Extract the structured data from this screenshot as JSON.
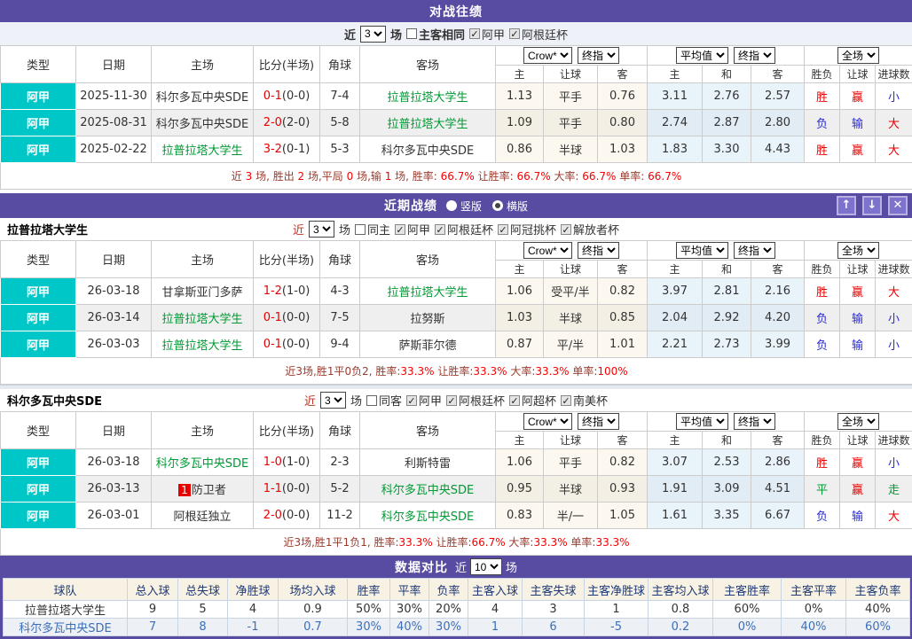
{
  "colors": {
    "purple": "#584CA2",
    "teal": "#00C7C7",
    "team_green": "#009933",
    "win_red": "#E60000",
    "lose_blue": "#2A2AD4",
    "draw_green": "#019934",
    "avg_bg": "#E9F3FA",
    "odds_bg": "#FCF8EF"
  },
  "thead": {
    "type": "类型",
    "date": "日期",
    "home": "主场",
    "score": "比分(半场)",
    "corner": "角球",
    "away": "客场",
    "crow": "Crow*",
    "final": "终指",
    "avg": "平均值",
    "full": "全场",
    "h_home": "主",
    "h_handicap": "让球",
    "h_away": "客",
    "a_home": "主",
    "a_draw": "和",
    "a_away": "客",
    "r_result": "胜负",
    "r_handicap": "让球",
    "r_goals": "进球数"
  },
  "h2h": {
    "title": "对战往绩",
    "filter": {
      "near": "近",
      "count": "3",
      "unit": "场",
      "checks": [
        {
          "label": "主客相同",
          "checked": false
        },
        {
          "label": "阿甲",
          "checked": true
        },
        {
          "label": "阿根廷杯",
          "checked": true
        }
      ]
    },
    "rows": [
      {
        "type": "阿甲",
        "date": "2025-11-30",
        "home": "科尔多瓦中央SDE",
        "home_green": false,
        "badge": "",
        "score": "0-1",
        "half": "(0-0)",
        "corner": "7-4",
        "away": "拉普拉塔大学生",
        "away_green": true,
        "o1": "1.13",
        "o2": "平手",
        "o3": "0.76",
        "a1": "3.11",
        "a2": "2.76",
        "a3": "2.57",
        "r1": {
          "t": "胜",
          "c": "red"
        },
        "r2": {
          "t": "赢",
          "c": "red"
        },
        "r3": {
          "t": "小",
          "c": "blue"
        }
      },
      {
        "type": "阿甲",
        "date": "2025-08-31",
        "home": "科尔多瓦中央SDE",
        "home_green": false,
        "badge": "",
        "score": "2-0",
        "half": "(2-0)",
        "corner": "5-8",
        "away": "拉普拉塔大学生",
        "away_green": true,
        "o1": "1.09",
        "o2": "平手",
        "o3": "0.80",
        "a1": "2.74",
        "a2": "2.87",
        "a3": "2.80",
        "r1": {
          "t": "负",
          "c": "blue"
        },
        "r2": {
          "t": "输",
          "c": "blue"
        },
        "r3": {
          "t": "大",
          "c": "red"
        }
      },
      {
        "type": "阿甲",
        "date": "2025-02-22",
        "home": "拉普拉塔大学生",
        "home_green": true,
        "badge": "",
        "score": "3-2",
        "half": "(0-1)",
        "corner": "5-3",
        "away": "科尔多瓦中央SDE",
        "away_green": false,
        "o1": "0.86",
        "o2": "半球",
        "o3": "1.03",
        "a1": "1.83",
        "a2": "3.30",
        "a3": "4.43",
        "r1": {
          "t": "胜",
          "c": "red"
        },
        "r2": {
          "t": "赢",
          "c": "red"
        },
        "r3": {
          "t": "大",
          "c": "red"
        }
      }
    ],
    "summary": [
      {
        "t": "近 ",
        "c": "dk"
      },
      {
        "t": "3",
        "c": "red"
      },
      {
        "t": " 场, 胜出 ",
        "c": "dk"
      },
      {
        "t": "2",
        "c": "red"
      },
      {
        "t": " 场,平局 ",
        "c": "dk"
      },
      {
        "t": "0",
        "c": "red"
      },
      {
        "t": " 场,输 ",
        "c": "dk"
      },
      {
        "t": "1",
        "c": "red"
      },
      {
        "t": " 场, 胜率: ",
        "c": "dk"
      },
      {
        "t": "66.7%",
        "c": "red"
      },
      {
        "t": " 让胜率: ",
        "c": "dk"
      },
      {
        "t": "66.7%",
        "c": "red"
      },
      {
        "t": " 大率: ",
        "c": "dk"
      },
      {
        "t": "66.7%",
        "c": "red"
      },
      {
        "t": " 单率: ",
        "c": "dk"
      },
      {
        "t": "66.7%",
        "c": "red"
      }
    ]
  },
  "recent": {
    "title": "近期战绩",
    "radios": [
      {
        "label": "竖版",
        "checked": false
      },
      {
        "label": "横版",
        "checked": true
      }
    ],
    "buttons": {
      "up": "↑",
      "down": "↓",
      "close": "✕"
    },
    "teams": [
      {
        "name": "拉普拉塔大学生",
        "filter": {
          "near": "近",
          "count": "3",
          "unit": "场",
          "checks": [
            {
              "label": "同主",
              "checked": false
            },
            {
              "label": "阿甲",
              "checked": true
            },
            {
              "label": "阿根廷杯",
              "checked": true
            },
            {
              "label": "阿冠挑杯",
              "checked": true
            },
            {
              "label": "解放者杯",
              "checked": true
            }
          ]
        },
        "rows": [
          {
            "type": "阿甲",
            "date": "26-03-18",
            "home": "甘拿斯亚门多萨",
            "home_green": false,
            "badge": "",
            "score": "1-2",
            "half": "(1-0)",
            "corner": "4-3",
            "away": "拉普拉塔大学生",
            "away_green": true,
            "o1": "1.06",
            "o2": "受平/半",
            "o3": "0.82",
            "a1": "3.97",
            "a2": "2.81",
            "a3": "2.16",
            "r1": {
              "t": "胜",
              "c": "red"
            },
            "r2": {
              "t": "赢",
              "c": "red"
            },
            "r3": {
              "t": "大",
              "c": "red"
            }
          },
          {
            "type": "阿甲",
            "date": "26-03-14",
            "home": "拉普拉塔大学生",
            "home_green": true,
            "badge": "",
            "score": "0-1",
            "half": "(0-0)",
            "corner": "7-5",
            "away": "拉努斯",
            "away_green": false,
            "o1": "1.03",
            "o2": "半球",
            "o3": "0.85",
            "a1": "2.04",
            "a2": "2.92",
            "a3": "4.20",
            "r1": {
              "t": "负",
              "c": "blue"
            },
            "r2": {
              "t": "输",
              "c": "blue"
            },
            "r3": {
              "t": "小",
              "c": "blue"
            }
          },
          {
            "type": "阿甲",
            "date": "26-03-03",
            "home": "拉普拉塔大学生",
            "home_green": true,
            "badge": "",
            "score": "0-1",
            "half": "(0-0)",
            "corner": "9-4",
            "away": "萨斯菲尔德",
            "away_green": false,
            "o1": "0.87",
            "o2": "平/半",
            "o3": "1.01",
            "a1": "2.21",
            "a2": "2.73",
            "a3": "3.99",
            "r1": {
              "t": "负",
              "c": "blue"
            },
            "r2": {
              "t": "输",
              "c": "blue"
            },
            "r3": {
              "t": "小",
              "c": "blue"
            }
          }
        ],
        "summary": [
          {
            "t": "近3场,胜1平0负2, 胜率:",
            "c": "dk"
          },
          {
            "t": "33.3%",
            "c": "red"
          },
          {
            "t": " 让胜率:",
            "c": "dk"
          },
          {
            "t": "33.3%",
            "c": "red"
          },
          {
            "t": " 大率:",
            "c": "dk"
          },
          {
            "t": "33.3%",
            "c": "red"
          },
          {
            "t": " 单率:",
            "c": "dk"
          },
          {
            "t": "100%",
            "c": "red"
          }
        ]
      },
      {
        "name": "科尔多瓦中央SDE",
        "filter": {
          "near": "近",
          "count": "3",
          "unit": "场",
          "checks": [
            {
              "label": "同客",
              "checked": false
            },
            {
              "label": "阿甲",
              "checked": true
            },
            {
              "label": "阿根廷杯",
              "checked": true
            },
            {
              "label": "阿超杯",
              "checked": true
            },
            {
              "label": "南美杯",
              "checked": true
            }
          ]
        },
        "rows": [
          {
            "type": "阿甲",
            "date": "26-03-18",
            "home": "科尔多瓦中央SDE",
            "home_green": true,
            "badge": "",
            "score": "1-0",
            "half": "(1-0)",
            "corner": "2-3",
            "away": "利斯特雷",
            "away_green": false,
            "o1": "1.06",
            "o2": "平手",
            "o3": "0.82",
            "a1": "3.07",
            "a2": "2.53",
            "a3": "2.86",
            "r1": {
              "t": "胜",
              "c": "red"
            },
            "r2": {
              "t": "赢",
              "c": "red"
            },
            "r3": {
              "t": "小",
              "c": "blue"
            }
          },
          {
            "type": "阿甲",
            "date": "26-03-13",
            "home": "防卫者",
            "home_green": false,
            "badge": "1",
            "score": "1-1",
            "half": "(0-0)",
            "corner": "5-2",
            "away": "科尔多瓦中央SDE",
            "away_green": true,
            "o1": "0.95",
            "o2": "半球",
            "o3": "0.93",
            "a1": "1.91",
            "a2": "3.09",
            "a3": "4.51",
            "r1": {
              "t": "平",
              "c": "green"
            },
            "r2": {
              "t": "赢",
              "c": "red"
            },
            "r3": {
              "t": "走",
              "c": "green"
            }
          },
          {
            "type": "阿甲",
            "date": "26-03-01",
            "home": "阿根廷独立",
            "home_green": false,
            "badge": "",
            "score": "2-0",
            "half": "(0-0)",
            "corner": "11-2",
            "away": "科尔多瓦中央SDE",
            "away_green": true,
            "o1": "0.83",
            "o2": "半/一",
            "o3": "1.05",
            "a1": "1.61",
            "a2": "3.35",
            "a3": "6.67",
            "r1": {
              "t": "负",
              "c": "blue"
            },
            "r2": {
              "t": "输",
              "c": "blue"
            },
            "r3": {
              "t": "大",
              "c": "red"
            }
          }
        ],
        "summary": [
          {
            "t": "近3场,胜1平1负1, 胜率:",
            "c": "dk"
          },
          {
            "t": "33.3%",
            "c": "red"
          },
          {
            "t": " 让胜率:",
            "c": "dk"
          },
          {
            "t": "66.7%",
            "c": "red"
          },
          {
            "t": " 大率:",
            "c": "dk"
          },
          {
            "t": "33.3%",
            "c": "red"
          },
          {
            "t": " 单率:",
            "c": "dk"
          },
          {
            "t": "33.3%",
            "c": "red"
          }
        ]
      }
    ]
  },
  "compare": {
    "title": "数据对比",
    "near": "近",
    "count": "10",
    "unit": "场",
    "headers": [
      "球队",
      "总入球",
      "总失球",
      "净胜球",
      "场均入球",
      "胜率",
      "平率",
      "负率",
      "主客入球",
      "主客失球",
      "主客净胜球",
      "主客均入球",
      "主客胜率",
      "主客平率",
      "主客负率"
    ],
    "rows": [
      {
        "name": "拉普拉塔大学生",
        "values": [
          "9",
          "5",
          "4",
          "0.9",
          "50%",
          "30%",
          "20%",
          "4",
          "3",
          "1",
          "0.8",
          "60%",
          "0%",
          "40%"
        ]
      },
      {
        "name": "科尔多瓦中央SDE",
        "values": [
          "7",
          "8",
          "-1",
          "0.7",
          "30%",
          "40%",
          "30%",
          "1",
          "6",
          "-5",
          "0.2",
          "0%",
          "40%",
          "60%"
        ]
      }
    ]
  }
}
